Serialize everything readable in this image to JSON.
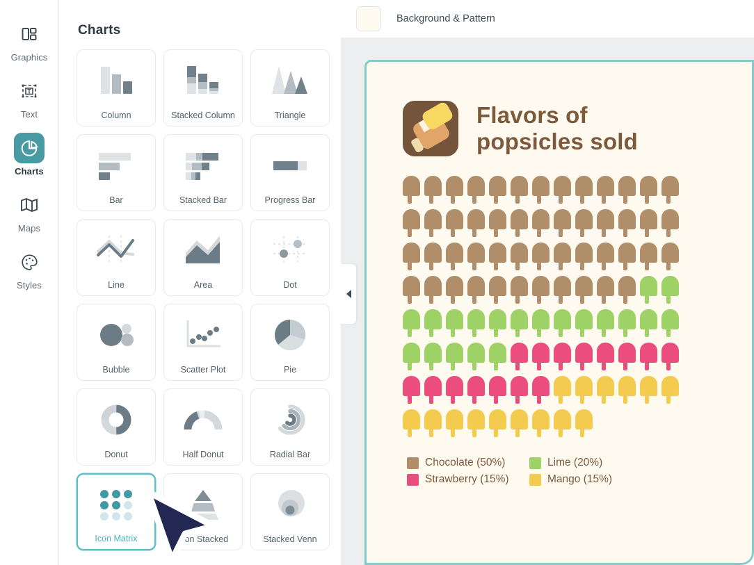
{
  "sidebar": {
    "items": [
      {
        "label": "Graphics",
        "icon": "graphics-icon",
        "active": false
      },
      {
        "label": "Text",
        "icon": "text-icon",
        "active": false
      },
      {
        "label": "Charts",
        "icon": "charts-pie-icon",
        "active": true
      },
      {
        "label": "Maps",
        "icon": "map-icon",
        "active": false
      },
      {
        "label": "Styles",
        "icon": "palette-icon",
        "active": false
      }
    ]
  },
  "panel": {
    "title": "Charts",
    "tiles": [
      {
        "label": "Column",
        "art": "column",
        "selected": false
      },
      {
        "label": "Stacked Column",
        "art": "stacked-column",
        "selected": false
      },
      {
        "label": "Triangle",
        "art": "triangle",
        "selected": false
      },
      {
        "label": "Bar",
        "art": "bar",
        "selected": false
      },
      {
        "label": "Stacked Bar",
        "art": "stacked-bar",
        "selected": false
      },
      {
        "label": "Progress Bar",
        "art": "progress-bar",
        "selected": false
      },
      {
        "label": "Line",
        "art": "line",
        "selected": false
      },
      {
        "label": "Area",
        "art": "area",
        "selected": false
      },
      {
        "label": "Dot",
        "art": "dot",
        "selected": false
      },
      {
        "label": "Bubble",
        "art": "bubble",
        "selected": false
      },
      {
        "label": "Scatter Plot",
        "art": "scatter",
        "selected": false
      },
      {
        "label": "Pie",
        "art": "pie",
        "selected": false
      },
      {
        "label": "Donut",
        "art": "donut",
        "selected": false
      },
      {
        "label": "Half Donut",
        "art": "half-donut",
        "selected": false
      },
      {
        "label": "Radial Bar",
        "art": "radial-bar",
        "selected": false
      },
      {
        "label": "Icon Matrix",
        "art": "icon-matrix",
        "selected": true
      },
      {
        "label": "Icon Stacked",
        "art": "icon-stacked",
        "selected": false
      },
      {
        "label": "Stacked Venn",
        "art": "stacked-venn",
        "selected": false
      }
    ]
  },
  "preview": {
    "topbar": {
      "label": "Background & Pattern",
      "swatch_color": "#fffaf0"
    },
    "collapse_icon": "chevron-left-icon",
    "canvas": {
      "background": "#fffaf0",
      "border_color": "#84c9ce",
      "logo_icon": "popsicle-logo-icon",
      "title": "Flavors of\npopsicles sold",
      "title_color": "#7d5a3c"
    }
  },
  "chart_data": {
    "type": "icon-matrix",
    "title": "Flavors of popsicles sold",
    "unit_icon": "popsicle-icon",
    "total_icons": 100,
    "columns": 13,
    "rows": 8,
    "categories": [
      "Chocolate",
      "Lime",
      "Strawberry",
      "Mango"
    ],
    "values": [
      50,
      20,
      15,
      15
    ],
    "value_unit": "%",
    "colors": [
      "#b08e6a",
      "#9ed267",
      "#ec4d7f",
      "#f3cc4f"
    ],
    "legend": [
      {
        "label": "Chocolate (50%)",
        "color": "#b08e6a"
      },
      {
        "label": "Lime (20%)",
        "color": "#9ed267"
      },
      {
        "label": "Strawberry (15%)",
        "color": "#ec4d7f"
      },
      {
        "label": "Mango (15%)",
        "color": "#f3cc4f"
      }
    ],
    "legend_position": "bottom-left",
    "grid": false
  },
  "cursor": {
    "icon": "mouse-pointer-icon",
    "color": "#232853"
  }
}
